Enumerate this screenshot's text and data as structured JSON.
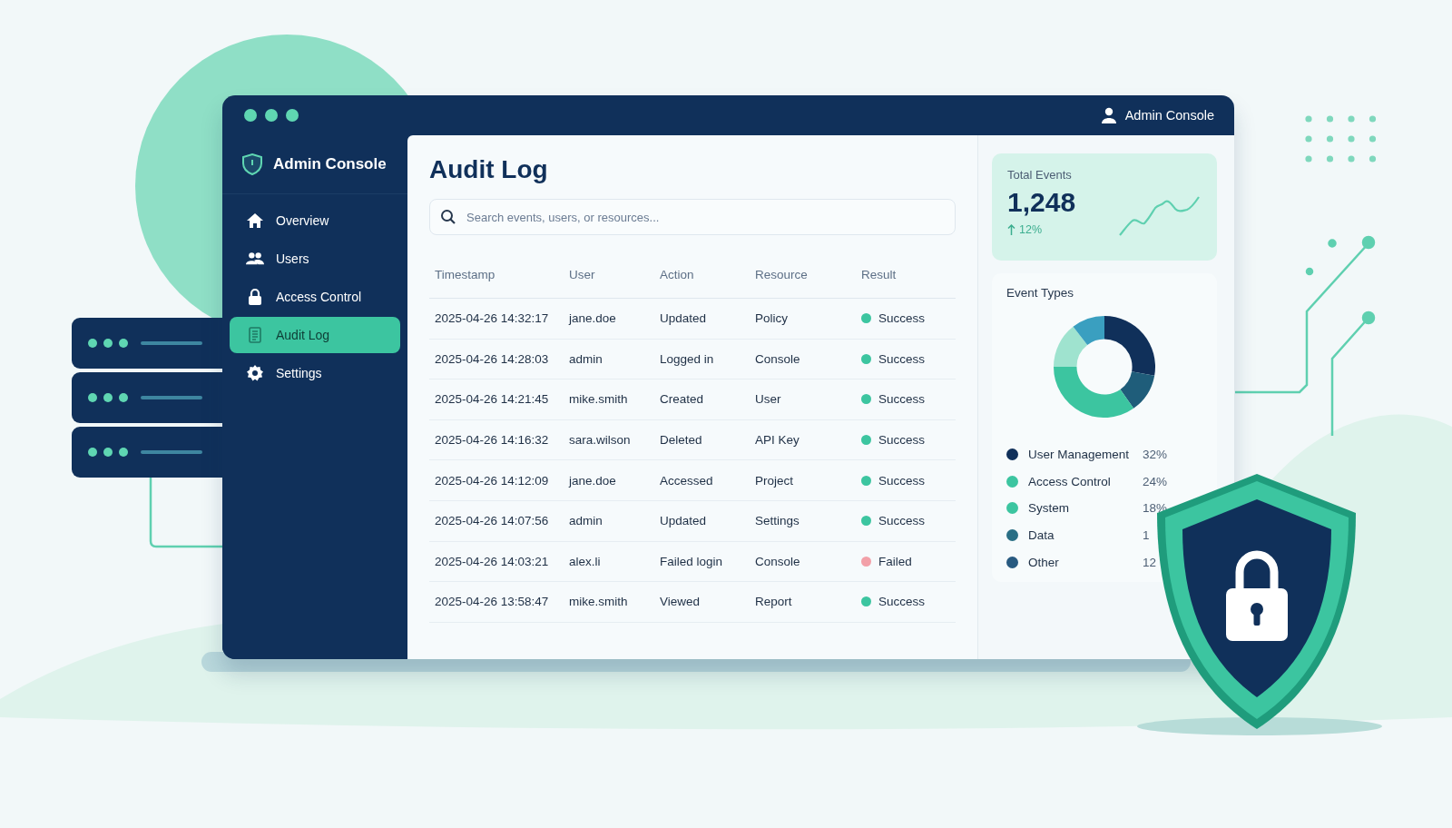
{
  "titlebar": {
    "user_label": "Admin Console"
  },
  "sidebar": {
    "brand": "Admin Console",
    "items": [
      {
        "label": "Overview",
        "kind": "home",
        "selected": false
      },
      {
        "label": "Users",
        "kind": "users",
        "selected": false
      },
      {
        "label": "Access Control",
        "kind": "lock",
        "selected": false
      },
      {
        "label": "Audit Log",
        "kind": "log",
        "selected": true
      },
      {
        "label": "Settings",
        "kind": "gear",
        "selected": false
      }
    ]
  },
  "main": {
    "title": "Audit Log",
    "search": {
      "placeholder": "Search events, users, or resources..."
    },
    "table": {
      "columns": [
        "Timestamp",
        "User",
        "Action",
        "Resource",
        "Result"
      ],
      "rows": [
        {
          "cells": [
            "2025-04-26 14:32:17",
            "jane.doe",
            "Updated",
            "Policy"
          ],
          "result": "Success",
          "color": "#3cc5a0"
        },
        {
          "cells": [
            "2025-04-26 14:28:03",
            "admin",
            "Logged in",
            "Console"
          ],
          "result": "Success",
          "color": "#3cc5a0"
        },
        {
          "cells": [
            "2025-04-26 14:21:45",
            "mike.smith",
            "Created",
            "User"
          ],
          "result": "Success",
          "color": "#3cc5a0"
        },
        {
          "cells": [
            "2025-04-26 14:16:32",
            "sara.wilson",
            "Deleted",
            "API Key"
          ],
          "result": "Success",
          "color": "#3cc5a0"
        },
        {
          "cells": [
            "2025-04-26 14:12:09",
            "jane.doe",
            "Accessed",
            "Project"
          ],
          "result": "Success",
          "color": "#3cc5a0"
        },
        {
          "cells": [
            "2025-04-26 14:07:56",
            "admin",
            "Updated",
            "Settings"
          ],
          "result": "Success",
          "color": "#3cc5a0"
        },
        {
          "cells": [
            "2025-04-26 14:03:21",
            "alex.li",
            "Failed login",
            "Console"
          ],
          "result": "Failed",
          "color": "#f2a0a8"
        },
        {
          "cells": [
            "2025-04-26 13:58:47",
            "mike.smith",
            "Viewed",
            "Report"
          ],
          "result": "Success",
          "color": "#3cc5a0"
        }
      ]
    }
  },
  "stats": {
    "label": "Total Events",
    "value": "1,248",
    "change": "12%"
  },
  "event_types": {
    "title": "Event Types",
    "legend": [
      {
        "label": "User Management",
        "value": "32%",
        "color": "#10305a"
      },
      {
        "label": "Access Control",
        "value": "24%",
        "color": "#3cc5a0"
      },
      {
        "label": "System",
        "value": "18%",
        "color": "#3cc5a0"
      },
      {
        "label": "Data",
        "value": "1",
        "color": "#2a6f85"
      },
      {
        "label": "Other",
        "value": "12",
        "color": "#285a80"
      }
    ]
  }
}
